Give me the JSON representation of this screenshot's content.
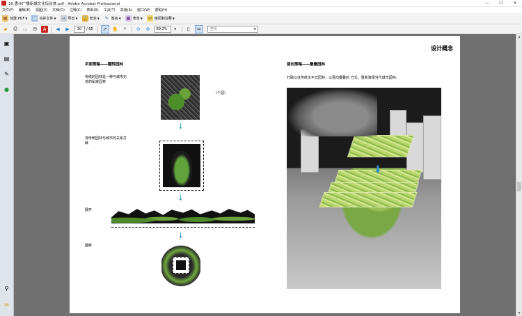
{
  "window": {
    "title": "10.惠州广播新城文化综合体.pdf - Adobe Acrobat Professional",
    "minimize": "—",
    "maximize": "☐",
    "close": "✕"
  },
  "menu": [
    "文件(F)",
    "编辑(E)",
    "视图(V)",
    "文档(D)",
    "注释(C)",
    "表单(R)",
    "工具(T)",
    "高级(A)",
    "窗口(W)",
    "帮助(H)"
  ],
  "toolbar": {
    "create_pdf": "创建 PDF",
    "combine": "合并文件",
    "export": "导出",
    "secure": "安全",
    "sign": "签名",
    "forms": "表单",
    "review": "审阅和注释"
  },
  "nav": {
    "current_page": "30",
    "total_pages": "/ 65",
    "zoom": "89.3%",
    "search_placeholder": "查找"
  },
  "page": {
    "title": "设计概念",
    "left_heading": "平面策略——翻转园林",
    "right_heading": "竖向策略——叠叠园林",
    "step1": "传统的园林是一种与城市无关的私家园林",
    "step1_note": "（个园）",
    "step2": "将传统园林与城市的关系打破",
    "step3": "展开",
    "step4": "翻转",
    "right_desc": "打破以往传统水平式园林，以竖向叠叠的 方式，重新演绎当代城市园林。"
  },
  "colors": {
    "accent_arrow": "#2d9ad3",
    "doc_background": "#707070",
    "nav_pane": "#dfe4ea"
  }
}
